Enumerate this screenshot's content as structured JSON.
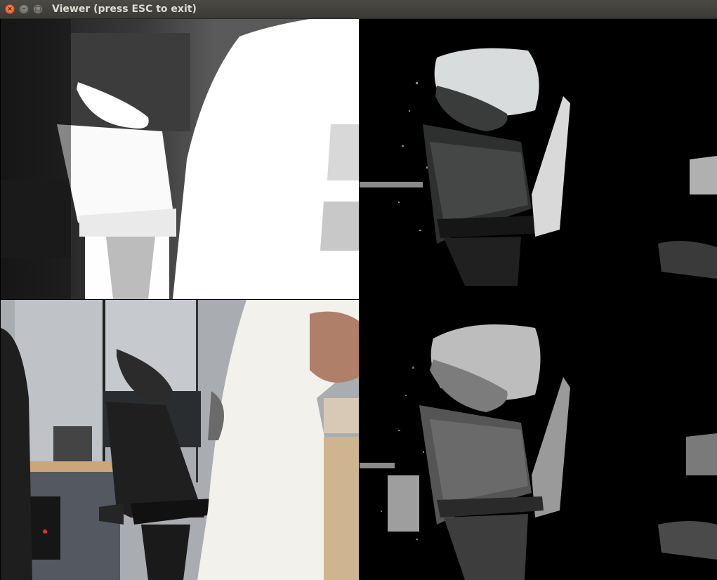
{
  "window": {
    "title": "Viewer (press ESC to exit)",
    "buttons": {
      "close": "×",
      "minimize": "–",
      "maximize": "□"
    }
  },
  "panes": [
    {
      "id": "ir",
      "icon": "infrared-frame"
    },
    {
      "id": "registered",
      "icon": "registered-color-frame"
    },
    {
      "id": "rgb",
      "icon": "color-frame"
    },
    {
      "id": "depth",
      "icon": "depth-frame"
    }
  ],
  "colors": {
    "titlebar": "#3c3b37",
    "close_button": "#e95420"
  }
}
